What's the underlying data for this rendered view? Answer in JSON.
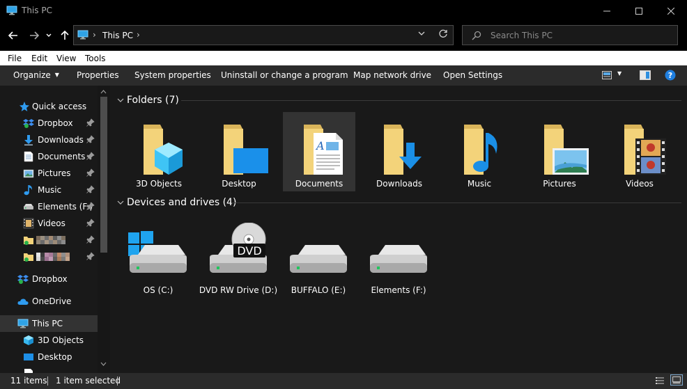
{
  "window": {
    "title": "This PC",
    "minimize_label": "—",
    "maximize_label": "☐",
    "close_label": "✕"
  },
  "nav": {
    "back_label": "←",
    "forward_label": "→",
    "recent_label": "⌄",
    "up_label": "↑",
    "address_path": "This PC",
    "address_sep": "›",
    "address_dropdown": "⌄",
    "refresh_label": "↻"
  },
  "search": {
    "placeholder": "Search This PC"
  },
  "menu": {
    "items": [
      "File",
      "Edit",
      "View",
      "Tools"
    ]
  },
  "commands": {
    "organize": "Organize",
    "properties": "Properties",
    "system_properties": "System properties",
    "uninstall": "Uninstall or change a program",
    "map_drive": "Map network drive",
    "open_settings": "Open Settings"
  },
  "sidebar": {
    "quick_access": "Quick access",
    "items": [
      {
        "label": "Dropbox",
        "icon": "dropbox-icon"
      },
      {
        "label": "Downloads",
        "icon": "downloads-icon"
      },
      {
        "label": "Documents",
        "icon": "documents-icon"
      },
      {
        "label": "Pictures",
        "icon": "pictures-icon"
      },
      {
        "label": "Music",
        "icon": "music-icon"
      },
      {
        "label": "Elements (F:)",
        "icon": "drive-icon"
      },
      {
        "label": "Videos",
        "icon": "videos-icon"
      }
    ],
    "dropbox": "Dropbox",
    "onedrive": "OneDrive",
    "this_pc": "This PC",
    "pc_children": [
      {
        "label": "3D Objects"
      },
      {
        "label": "Desktop"
      }
    ]
  },
  "main": {
    "folders_header": "Folders (7)",
    "folders": [
      {
        "label": "3D Objects"
      },
      {
        "label": "Desktop"
      },
      {
        "label": "Documents"
      },
      {
        "label": "Downloads"
      },
      {
        "label": "Music"
      },
      {
        "label": "Pictures"
      },
      {
        "label": "Videos"
      }
    ],
    "drives_header": "Devices and drives (4)",
    "drives": [
      {
        "label": "OS (C:)"
      },
      {
        "label": "DVD RW Drive (D:)",
        "badge": "DVD"
      },
      {
        "label": "BUFFALO (E:)"
      },
      {
        "label": "Elements (F:)"
      }
    ]
  },
  "status": {
    "items_count": "11 items",
    "selected": "1 item selected"
  },
  "colors": {
    "accent": "#1e90ff",
    "folder": "#f3d37a",
    "background": "#191919"
  }
}
